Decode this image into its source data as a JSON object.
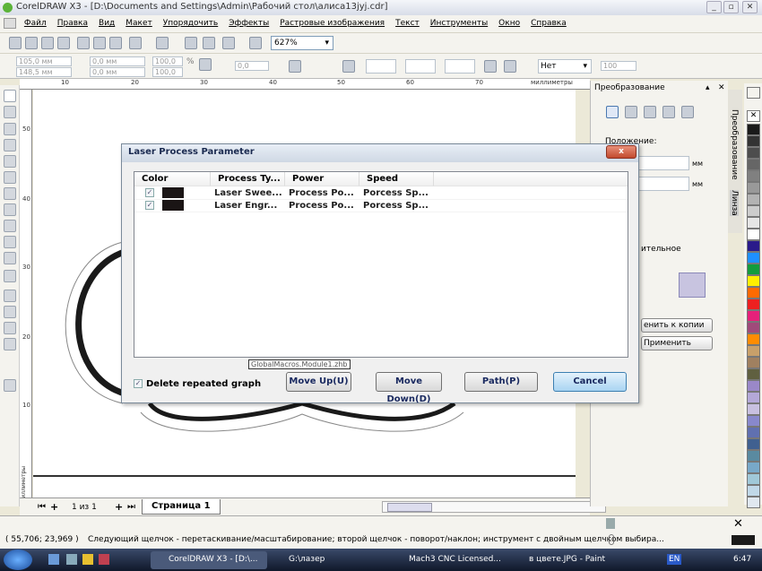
{
  "window": {
    "title": "CorelDRAW X3 - [D:\\Documents and Settings\\Admin\\Рабочий стол\\алиса13jyj.cdr]"
  },
  "menu": [
    "Файл",
    "Правка",
    "Вид",
    "Макет",
    "Упорядочить",
    "Эффекты",
    "Растровые изображения",
    "Текст",
    "Инструменты",
    "Окно",
    "Справка"
  ],
  "toolbar": {
    "zoom": "627%"
  },
  "propbar": {
    "x": "105,0 мм",
    "y": "148,5 мм",
    "w": "0,0 мм",
    "h": "0,0 мм",
    "scale_x": "100,0",
    "scale_y": "100,0",
    "pct": "%",
    "angle": "0,0",
    "outline": "Нет",
    "transparency": "100"
  },
  "ruler": {
    "top": [
      "10",
      "20",
      "30",
      "40",
      "50",
      "60",
      "70"
    ],
    "unit": "миллиметры",
    "left": [
      "50",
      "40",
      "30",
      "20",
      "10"
    ],
    "left_unit": "миллиметры"
  },
  "pages": {
    "counter": "1 из 1",
    "tab": "Страница 1"
  },
  "docker": {
    "title": "Преобразование",
    "position_label": "Положение:",
    "unit1": "мм",
    "unit2": "мм",
    "relative": "ительное",
    "apply_copy": "енить к копии",
    "apply": "Применить",
    "tab1": "Преобразование",
    "tab2": "Линза"
  },
  "palette": [
    "#1a1a1a",
    "#333333",
    "#4d4d4d",
    "#666666",
    "#808080",
    "#999999",
    "#b3b3b3",
    "#cccccc",
    "#e6e6e6",
    "#ffffff",
    "#2a1a8a",
    "#1e90ff",
    "#129c3c",
    "#ffee00",
    "#ff6a00",
    "#ee2020",
    "#e6207a",
    "#a04a7a",
    "#ff8c00",
    "#c8a06a",
    "#a08060",
    "#606040",
    "#9a88c8",
    "#b4a8d8",
    "#c8c0e0",
    "#8888cc",
    "#6070b0",
    "#406090",
    "#5a8aa0",
    "#78a8c8",
    "#a0c8d8",
    "#c0d8e8",
    "#e0e8f0"
  ],
  "status": {
    "coords": "( 55,706; 23,969 )",
    "hint": "Следующий щелчок - перетаскивание/масштабирование; второй щелчок - поворот/наклон; инструмент с двойным щелчком выбира..."
  },
  "taskbar": {
    "items": [
      "CorelDRAW X3 - [D:\\...",
      "G:\\лазер",
      "Mach3 CNC  Licensed...",
      "в цвете.JPG - Paint"
    ],
    "lang": "EN",
    "time": "6:47"
  },
  "dialog": {
    "title": "Laser Process Parameter",
    "close": "x",
    "columns": [
      "Color",
      "Process Ty...",
      "Power",
      "Speed"
    ],
    "rows": [
      {
        "checked": true,
        "color": "#1a1515",
        "process": "Laser Swee...",
        "power": "Process Po...",
        "speed": "Porcess Sp..."
      },
      {
        "checked": true,
        "color": "#1a1515",
        "process": "Laser Engr...",
        "power": "Process Po...",
        "speed": "Porcess Sp..."
      }
    ],
    "tooltip": "GlobalMacros.Module1.zhb",
    "delete_repeated": {
      "label": "Delete repeated graph",
      "checked": true
    },
    "buttons": {
      "move_up": "Move Up(U)",
      "move_down": "Move Down(D)",
      "path": "Path(P)",
      "cancel": "Cancel"
    }
  }
}
